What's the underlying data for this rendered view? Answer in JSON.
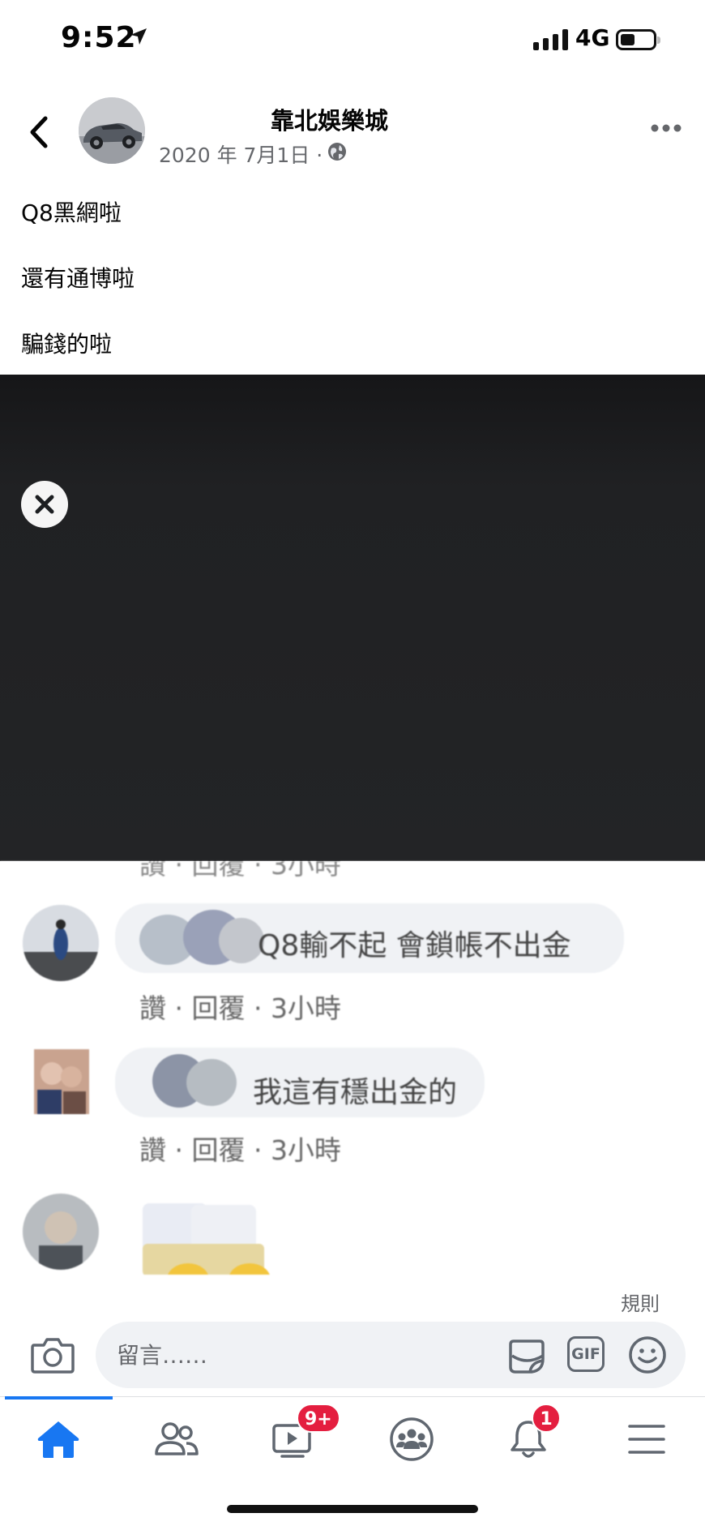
{
  "status_bar": {
    "time": "9:52",
    "network": "4G"
  },
  "post": {
    "page_name": "靠北娛樂城",
    "date": "2020 年 7月1日 ·",
    "lines": [
      "Q8黑網啦",
      "還有通博啦",
      "騙錢的啦"
    ]
  },
  "comments": [
    {
      "text": "Q8輸不起 會鎖帳不出金",
      "actions": "讚 · 回覆 · 3小時"
    },
    {
      "text": "我這有穩出金的",
      "actions": "讚 · 回覆 · 3小時"
    }
  ],
  "comment_bar": {
    "rules": "規則",
    "placeholder": "留言……",
    "gif": "GIF"
  },
  "tabs": [
    {
      "name": "home",
      "active": true
    },
    {
      "name": "friends"
    },
    {
      "name": "watch",
      "badge": "9+"
    },
    {
      "name": "groups"
    },
    {
      "name": "notifications",
      "badge": "1"
    },
    {
      "name": "menu"
    }
  ],
  "colors": {
    "accent": "#1877f2",
    "badge": "#e41e3f",
    "secondary_text": "#65676b"
  }
}
